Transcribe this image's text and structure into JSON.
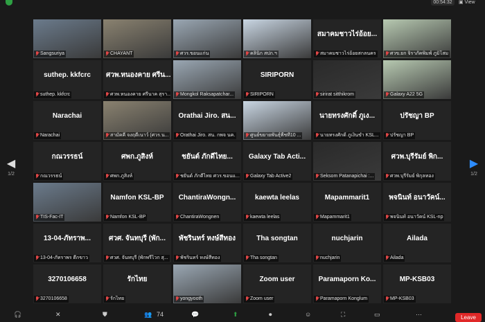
{
  "topbar": {
    "timer": "00:54:32",
    "view_label": "▣ View"
  },
  "pager": {
    "left_page": "1/2",
    "right_page": "1/2"
  },
  "toolbar": {
    "participants_count": "74",
    "leave_label": "Leave"
  },
  "tiles": [
    {
      "label": "Sangsuriya",
      "title": ""
    },
    {
      "label": "CHAYANT",
      "title": ""
    },
    {
      "label": "ศวร.ขอนแก่น",
      "title": ""
    },
    {
      "label": "คลินิก สปก.ฯ",
      "title": ""
    },
    {
      "label": "สมาคมชาวไร่อ้อยสกลนคร",
      "title": "สมาคมชาวไร่อ้อย..."
    },
    {
      "label": "ศวข.ยก จิราภัคพิมพ์ ภูมิโสม",
      "title": ""
    },
    {
      "label": "suthep. kkfcrc",
      "title": "suthep. kkfcrc"
    },
    {
      "label": "ศวพ.หนองคาย ศรีนาค สุรา...",
      "title": "ศวพ.หนองคาย ศรีน..."
    },
    {
      "label": "Mongkol Raksapatchar...",
      "title": ""
    },
    {
      "label": "SIRIPORN",
      "title": "SIRIPORN"
    },
    {
      "label": "sirirat sitthikrom",
      "title": ""
    },
    {
      "label": "Galaxy A22 5G",
      "title": ""
    },
    {
      "label": "Narachai",
      "title": "Narachai"
    },
    {
      "label": "สามัคคี จงฤดีเนาว์ (ศวร.น...",
      "title": ""
    },
    {
      "label": "Orathai Jiro. สน. กพจ นค.",
      "title": "Orathai Jiro. สน..."
    },
    {
      "label": "ศูนย์ขยายพันธุ์พืชที่10 ...",
      "title": ""
    },
    {
      "label": "นายทรงศักดิ์ ภูเงินขำ KSL...",
      "title": "นายทรงศักดิ์ ภูเง..."
    },
    {
      "label": "ปรัชญา BP",
      "title": "ปรัชญา BP"
    },
    {
      "label": "กณวรรธน์",
      "title": "กณวรรธน์"
    },
    {
      "label": "ศพก.ภูสิงห์",
      "title": "ศพก.ภูสิงห์"
    },
    {
      "label": "ชยันต์ ภักดีไทย ศวร.ขอนแ...",
      "title": "ชยันต์ ภักดีไทย..."
    },
    {
      "label": "Galaxy Tab Active2",
      "title": "Galaxy Tab Acti..."
    },
    {
      "label": "Seksom Patanapichai :...",
      "title": ""
    },
    {
      "label": "ศวพ.บุรีรัมย์ พิกุลทอง",
      "title": "ศวพ.บุรีรัมย์ พิก..."
    },
    {
      "label": "TIS-Fac-IT",
      "title": ""
    },
    {
      "label": "Namfon KSL-BP",
      "title": "Namfon KSL-BP"
    },
    {
      "label": "ChantiraWongnen",
      "title": "ChantiraWongn..."
    },
    {
      "label": "kaewta leelas",
      "title": "kaewta leelas"
    },
    {
      "label": "Mapammarit1",
      "title": "Mapammarit1"
    },
    {
      "label": "พจนินท์ อนาวัคน์ KSL-np",
      "title": "พจนินท์ อนาวัคน์..."
    },
    {
      "label": "13-04-ภัทราพร ดีกขาว",
      "title": "13-04-ภัทราพ..."
    },
    {
      "label": "ศวศ. จันทบุรี (พักพรีไวก สุ...",
      "title": "ศวศ. จันทบุรี (พัก..."
    },
    {
      "label": "พัชรินทร์ หงษ์สีทอง",
      "title": "พัชรินทร์ หงษ์สีทอง"
    },
    {
      "label": "Tha songtan",
      "title": "Tha songtan"
    },
    {
      "label": "nuchjarin",
      "title": "nuchjarin"
    },
    {
      "label": "Ailada",
      "title": "Ailada"
    },
    {
      "label": "3270106658",
      "title": "3270106658"
    },
    {
      "label": "รักไทย",
      "title": "รักไทย"
    },
    {
      "label": "yongyooth",
      "title": ""
    },
    {
      "label": "Zoom user",
      "title": "Zoom user"
    },
    {
      "label": "Paramaporn Konglum",
      "title": "Paramaporn Ko..."
    },
    {
      "label": "MP-KSB03",
      "title": "MP-KSB03"
    }
  ],
  "colors": {
    "active_outline": "#9fd95a",
    "muted_mic": "#e04747",
    "leave": "#e02828"
  }
}
